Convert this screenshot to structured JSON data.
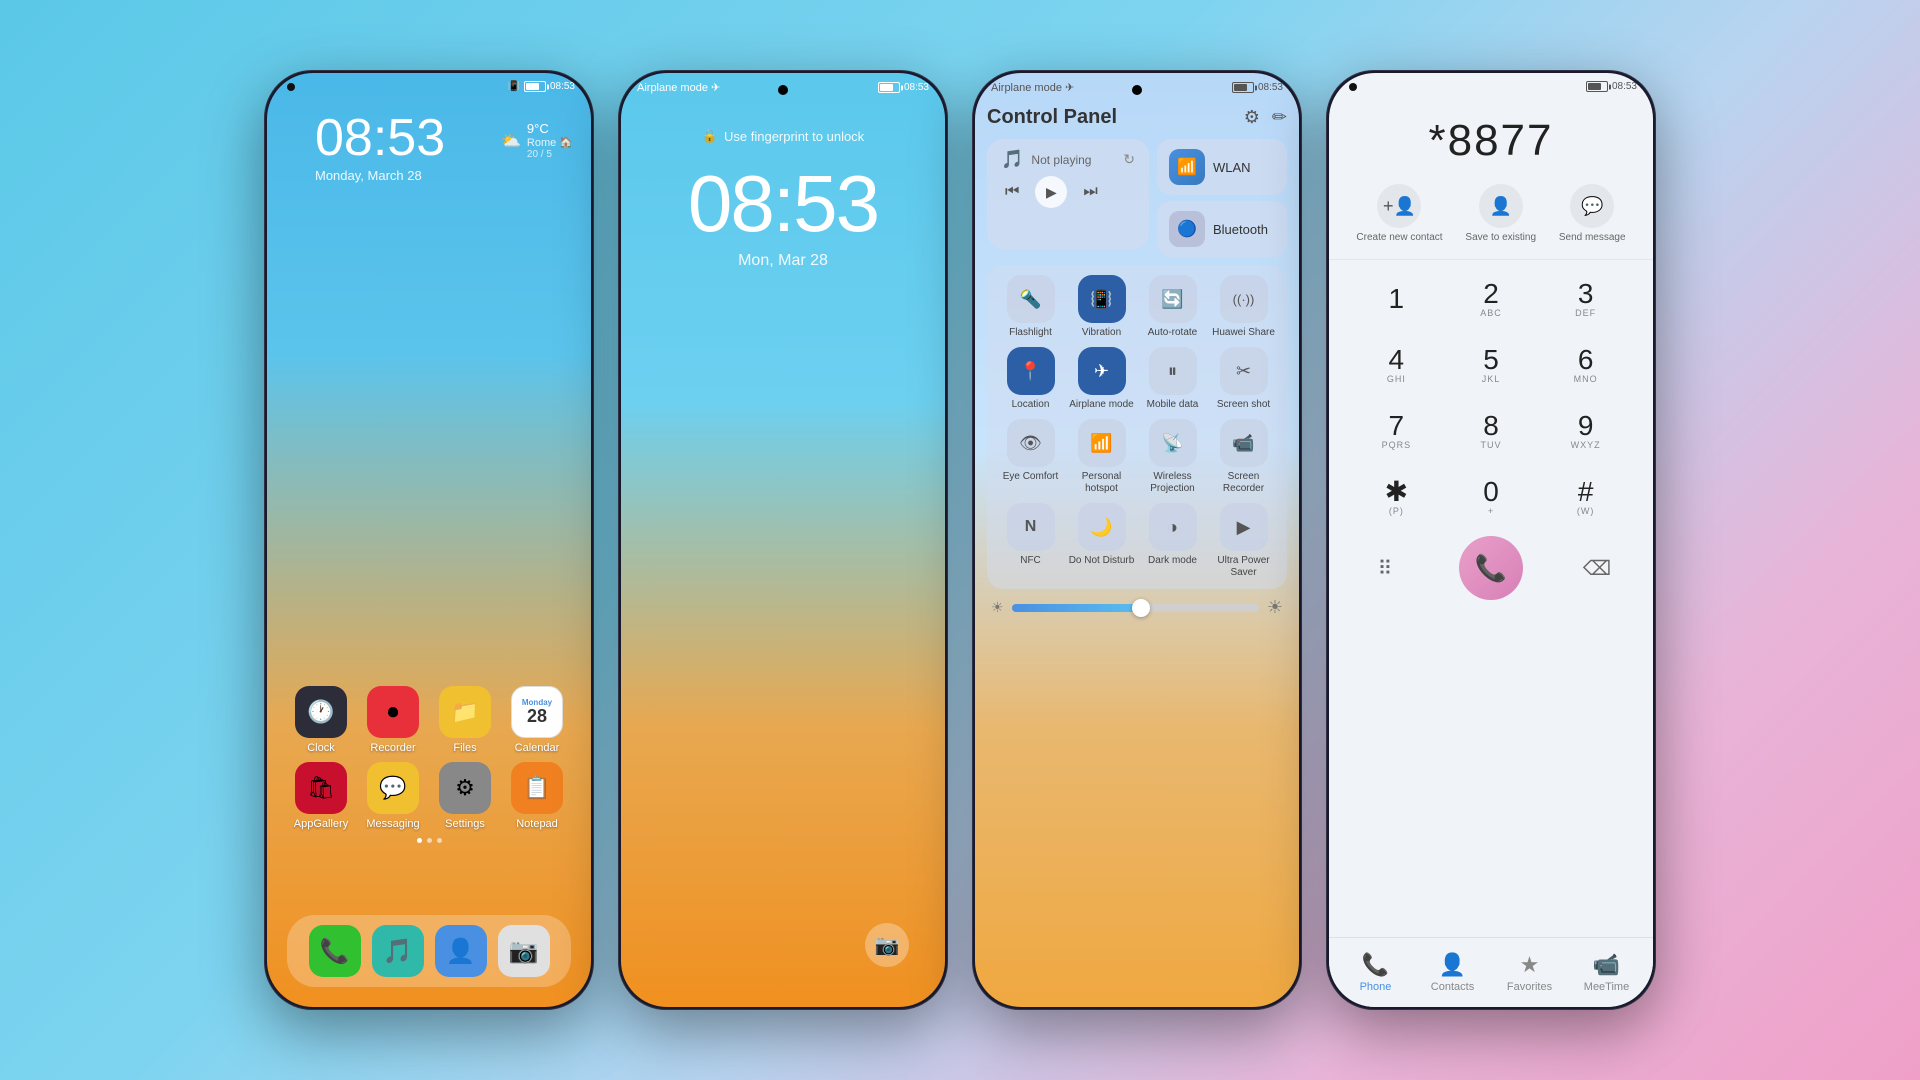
{
  "phone1": {
    "status_left": "",
    "status_time": "08:53",
    "time": "08:53",
    "date": "Monday, March 28",
    "weather_icon": "⛅",
    "weather_temp": "9°C",
    "weather_city": "Rome 🏠",
    "weather_range": "20 / 5",
    "apps_row1": [
      {
        "label": "Clock",
        "icon": "🕐",
        "bg": "#2d2d3a"
      },
      {
        "label": "Recorder",
        "icon": "⏺",
        "bg": "#e8303a"
      },
      {
        "label": "Files",
        "icon": "📁",
        "bg": "#f0c030"
      },
      {
        "label": "Calendar",
        "icon": "📅",
        "bg": "#fff"
      }
    ],
    "apps_row2": [
      {
        "label": "AppGallery",
        "icon": "🛍",
        "bg": "#c8102e"
      },
      {
        "label": "Messaging",
        "icon": "💬",
        "bg": "#f0c030"
      },
      {
        "label": "Settings",
        "icon": "⚙",
        "bg": "#888"
      },
      {
        "label": "Notepad",
        "icon": "📋",
        "bg": "#f08020"
      }
    ],
    "dock": [
      {
        "icon": "📞",
        "bg": "#30c030"
      },
      {
        "icon": "🎵",
        "bg": "#30b8a8"
      },
      {
        "icon": "👤",
        "bg": "#4a90e2"
      },
      {
        "icon": "📷",
        "bg": "#e0e0e0"
      }
    ]
  },
  "phone2": {
    "status_time": "08:53",
    "fingerprint_text": "Use fingerprint to unlock",
    "lock_time": "08:53",
    "lock_date": "Mon, Mar 28"
  },
  "phone3": {
    "status_time": "08:53",
    "title": "Control Panel",
    "now_playing": "Not playing",
    "wlan_label": "WLAN",
    "bluetooth_label": "Bluetooth",
    "items": [
      {
        "label": "Flashlight",
        "icon": "🔦",
        "active": false
      },
      {
        "label": "Vibration",
        "icon": "📳",
        "active": true
      },
      {
        "label": "Auto-rotate",
        "icon": "🔄",
        "active": false
      },
      {
        "label": "Huawei Share",
        "icon": "((·))",
        "active": false
      },
      {
        "label": "Location",
        "icon": "📍",
        "active": true
      },
      {
        "label": "Airplane mode",
        "icon": "✈",
        "active": true
      },
      {
        "label": "Mobile data",
        "icon": "⏸",
        "active": false
      },
      {
        "label": "Screen shot",
        "icon": "✂",
        "active": false
      },
      {
        "label": "Eye Comfort",
        "icon": "👁",
        "active": false
      },
      {
        "label": "Personal hotspot",
        "icon": "📶",
        "active": false
      },
      {
        "label": "Wireless Projection",
        "icon": "📡",
        "active": false
      },
      {
        "label": "Screen Recorder",
        "icon": "📹",
        "active": false
      },
      {
        "label": "NFC",
        "icon": "N",
        "active": false
      },
      {
        "label": "Do Not Disturb",
        "icon": "🌙",
        "active": false
      },
      {
        "label": "Dark mode",
        "icon": "◑",
        "active": false
      },
      {
        "label": "Ultra Power Saver",
        "icon": "▶",
        "active": false
      }
    ]
  },
  "phone4": {
    "status_time": "08:53",
    "dialed": "*8877",
    "create_contact": "Create new contact",
    "save_existing": "Save to existing",
    "send_message": "Send message",
    "keys": [
      {
        "num": "1",
        "letters": ""
      },
      {
        "num": "2",
        "letters": "ABC"
      },
      {
        "num": "3",
        "letters": "DEF"
      },
      {
        "num": "4",
        "letters": "GHI"
      },
      {
        "num": "5",
        "letters": "JKL"
      },
      {
        "num": "6",
        "letters": "MNO"
      },
      {
        "num": "7",
        "letters": "PQRS"
      },
      {
        "num": "8",
        "letters": "TUV"
      },
      {
        "num": "9",
        "letters": "WXYZ"
      },
      {
        "num": "*",
        "letters": "(P)"
      },
      {
        "num": "0",
        "letters": "+"
      },
      {
        "num": "#",
        "letters": "(W)"
      }
    ],
    "nav": [
      {
        "label": "Phone",
        "icon": "📞",
        "active": true
      },
      {
        "label": "Contacts",
        "icon": "👤",
        "active": false
      },
      {
        "label": "Favorites",
        "icon": "★",
        "active": false
      },
      {
        "label": "MeeTime",
        "icon": "📹",
        "active": false
      }
    ]
  }
}
